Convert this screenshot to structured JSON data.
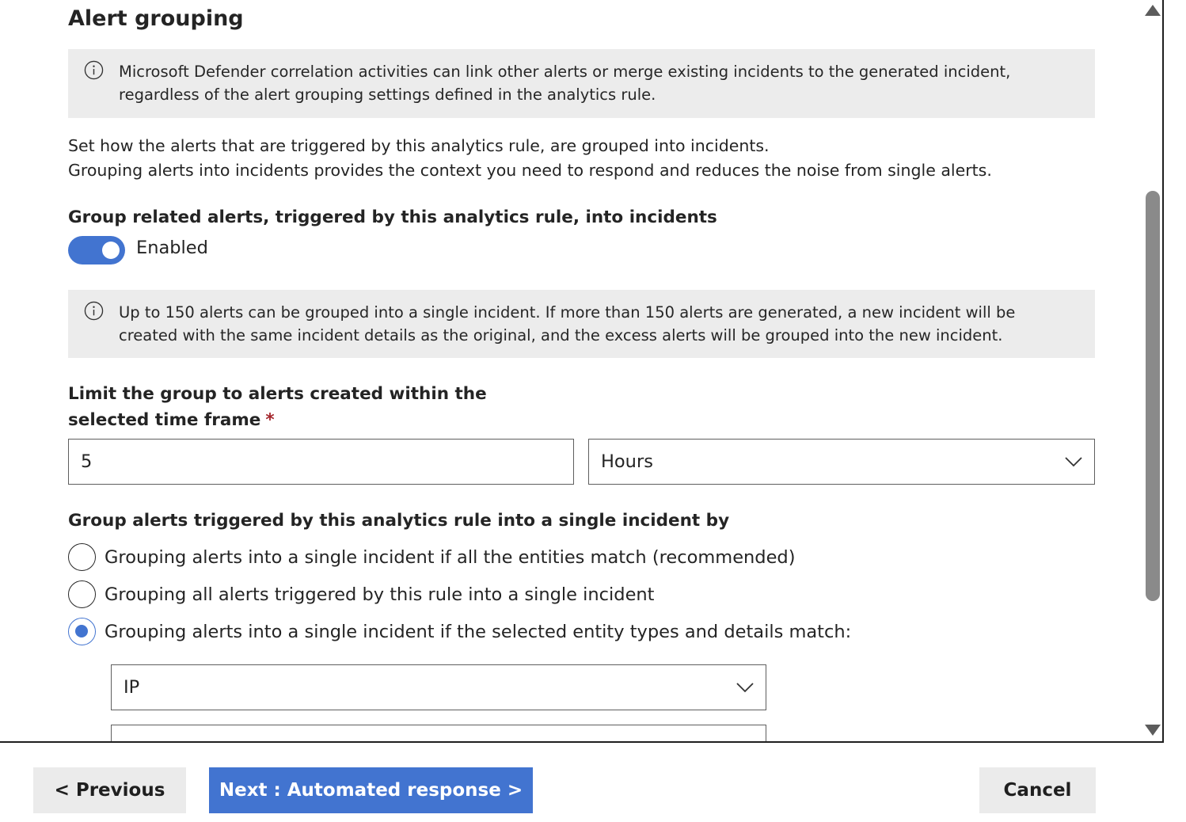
{
  "section_title": "Alert grouping",
  "info_notes": {
    "correlation": "Microsoft Defender correlation activities can link other alerts or merge existing incidents to the generated incident, regardless of the alert grouping settings defined in the analytics rule.",
    "limit": "Up to 150 alerts can be grouped into a single incident. If more than 150 alerts are generated, a new incident will be created with the same incident details as the original, and the excess alerts will be grouped into the new incident."
  },
  "description": {
    "line1": "Set how the alerts that are triggered by this analytics rule, are grouped into incidents.",
    "line2": "Grouping alerts into incidents provides the context you need to respond and reduces the noise from single alerts."
  },
  "group_toggle": {
    "label": "Group related alerts, triggered by this analytics rule, into incidents",
    "state_label": "Enabled",
    "enabled": true
  },
  "time_frame": {
    "label": "Limit the group to alerts created within the selected time frame",
    "required_marker": "*",
    "value": "5",
    "unit": "Hours"
  },
  "grouping_method": {
    "label": "Group alerts triggered by this analytics rule into a single incident by",
    "options": [
      {
        "label": "Grouping alerts into a single incident if all the entities match (recommended)",
        "selected": false
      },
      {
        "label": "Grouping all alerts triggered by this rule into a single incident",
        "selected": false
      },
      {
        "label": "Grouping alerts into a single incident if the selected entity types and details match:",
        "selected": true
      }
    ],
    "entity_type": "IP"
  },
  "footer": {
    "previous_label": "< Previous",
    "next_label": "Next : Automated response >",
    "cancel_label": "Cancel"
  },
  "colors": {
    "accent": "#4274d0",
    "info_background": "#ececec",
    "required": "#a4262c"
  }
}
